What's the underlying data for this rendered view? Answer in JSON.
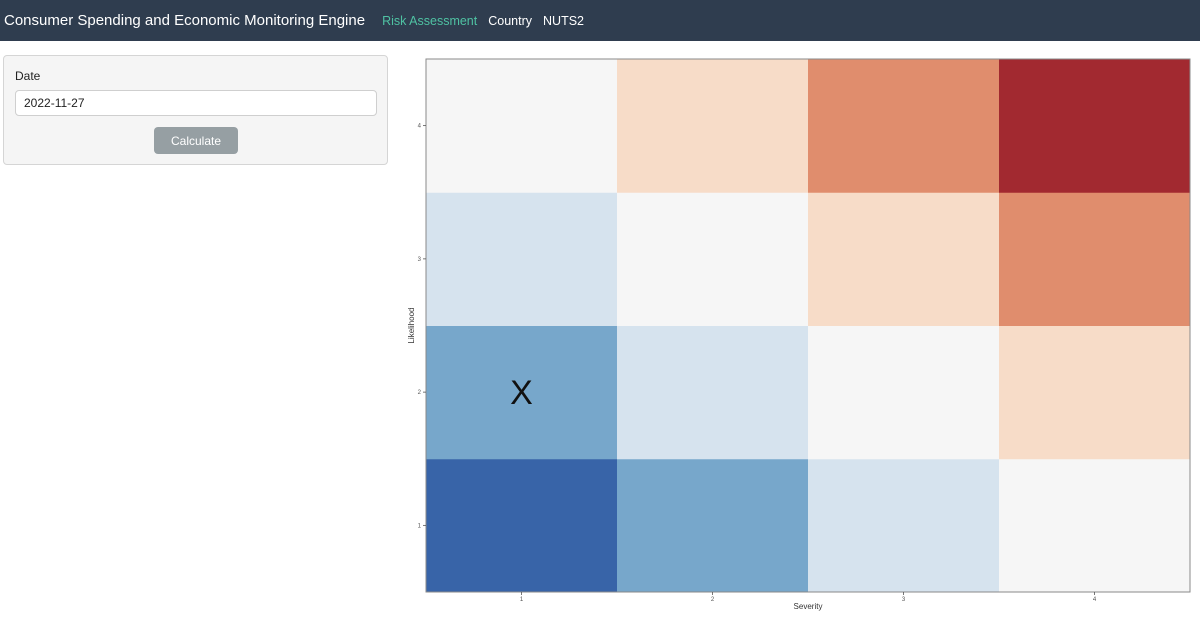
{
  "navbar": {
    "brand": "Consumer Spending and Economic Monitoring Engine",
    "links": [
      {
        "label": "Risk Assessment",
        "active": true
      },
      {
        "label": "Country",
        "active": false
      },
      {
        "label": "NUTS2",
        "active": false
      }
    ]
  },
  "sidebar": {
    "date_label": "Date",
    "date_value": "2022-11-27",
    "calculate_label": "Calculate"
  },
  "colors": {
    "navbar_bg": "#2f3d4f",
    "active_link": "#4fc2a3",
    "button_bg": "#969fa3"
  },
  "chart_data": {
    "type": "heatmap",
    "xlabel": "Severity",
    "ylabel": "Likelihood",
    "x_categories": [
      "1",
      "2",
      "3",
      "4"
    ],
    "y_categories": [
      "1",
      "2",
      "3",
      "4"
    ],
    "marker": {
      "label": "X",
      "severity": "1",
      "likelihood": "2"
    },
    "cells": [
      {
        "severity": 1,
        "likelihood": 1,
        "color": "#3864a8"
      },
      {
        "severity": 2,
        "likelihood": 1,
        "color": "#77a7cb"
      },
      {
        "severity": 3,
        "likelihood": 1,
        "color": "#d6e3ee"
      },
      {
        "severity": 4,
        "likelihood": 1,
        "color": "#f6f6f6"
      },
      {
        "severity": 1,
        "likelihood": 2,
        "color": "#77a7cb"
      },
      {
        "severity": 2,
        "likelihood": 2,
        "color": "#d6e3ee"
      },
      {
        "severity": 3,
        "likelihood": 2,
        "color": "#f6f6f6"
      },
      {
        "severity": 4,
        "likelihood": 2,
        "color": "#f7dcc8"
      },
      {
        "severity": 1,
        "likelihood": 3,
        "color": "#d6e3ee"
      },
      {
        "severity": 2,
        "likelihood": 3,
        "color": "#f6f6f6"
      },
      {
        "severity": 3,
        "likelihood": 3,
        "color": "#f7dcc8"
      },
      {
        "severity": 4,
        "likelihood": 3,
        "color": "#e08d6d"
      },
      {
        "severity": 1,
        "likelihood": 4,
        "color": "#f6f6f6"
      },
      {
        "severity": 2,
        "likelihood": 4,
        "color": "#f7dcc8"
      },
      {
        "severity": 3,
        "likelihood": 4,
        "color": "#e08d6d"
      },
      {
        "severity": 4,
        "likelihood": 4,
        "color": "#a22930"
      }
    ]
  }
}
